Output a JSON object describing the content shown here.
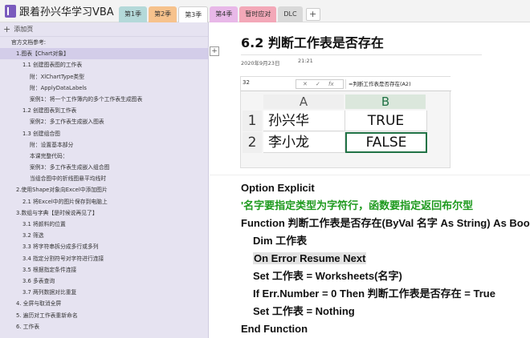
{
  "notebook": {
    "title": "跟着孙兴华学习VBA"
  },
  "section_tabs": [
    {
      "label": "第1季",
      "color": "#b4d9d9"
    },
    {
      "label": "第2季",
      "color": "#f6c28c"
    },
    {
      "label": "第3季",
      "color": "#ffffff"
    },
    {
      "label": "第4季",
      "color": "#e8b8e8"
    },
    {
      "label": "暂时应对",
      "color": "#f3a8b8"
    },
    {
      "label": "DLC",
      "color": "#d9d9d9"
    }
  ],
  "sidebar": {
    "add_page": "添加页",
    "items": [
      {
        "label": "官方文档参考:",
        "level": 0
      },
      {
        "label": "1.图表【Chart对象】",
        "level": 1,
        "selected": true
      },
      {
        "label": "1.1 创建图表图的工作表",
        "level": 2
      },
      {
        "label": "附：XlChartType类型",
        "level": 3
      },
      {
        "label": "附：ApplyDataLabels",
        "level": 3
      },
      {
        "label": "案例1：将一个工作簿内的多个工作表生成图表",
        "level": 3
      },
      {
        "label": "1.2 创建图表到工作表",
        "level": 2
      },
      {
        "label": "案例2：多工作表生成嵌入图表",
        "level": 3
      },
      {
        "label": "1.3 创建组合图",
        "level": 2
      },
      {
        "label": "附：设置基本部分",
        "level": 3
      },
      {
        "label": "本课完整代码：",
        "level": 3
      },
      {
        "label": "案例3：多工作表生成嵌入组合图",
        "level": 3
      },
      {
        "label": "当组合图中的折线图悬平均线时",
        "level": 3
      },
      {
        "label": "2.使用Shape对象向Excel中添加图片",
        "level": 1
      },
      {
        "label": "2.1 将Excel中的图片保存到电脑上",
        "level": 2
      },
      {
        "label": "3.数组与字典【是时候说再见了】",
        "level": 1
      },
      {
        "label": "3.1 将颜料的位置",
        "level": 2
      },
      {
        "label": "3.2 筛选",
        "level": 2
      },
      {
        "label": "3.3 将字符串拆分成多行或多列",
        "level": 2
      },
      {
        "label": "3.4 指定分割符号对字符进行连接",
        "level": 2
      },
      {
        "label": "3.5 根据指定条件连接",
        "level": 2
      },
      {
        "label": "3.6 多表查询",
        "level": 2
      },
      {
        "label": "3.7 两列数据对比重复",
        "level": 2
      },
      {
        "label": "4. 全屏与取消全屏",
        "level": 1
      },
      {
        "label": "5. 遍历对工作表重新命名",
        "level": 1
      },
      {
        "label": "6. 工作表",
        "level": 1
      }
    ]
  },
  "page": {
    "title": "6.2 判断工作表是否存在",
    "date": "2020年9月23日",
    "time": "21:21"
  },
  "excel": {
    "name_box": "32",
    "cancel_icon": "✕",
    "enter_icon": "✓",
    "fx_label": "fx",
    "formula": "=判断工作表是否存在(A2)",
    "columns": [
      "A",
      "B"
    ],
    "rows": [
      {
        "num": "1",
        "a": "孙兴华",
        "b": "TRUE"
      },
      {
        "num": "2",
        "a": "李小龙",
        "b": "FALSE"
      }
    ]
  },
  "code": {
    "lines": [
      {
        "text": "Option Explicit",
        "type": "normal"
      },
      {
        "text": "'名字要指定类型为字符行，函数要指定返回布尔型",
        "type": "comment"
      },
      {
        "text": "Function 判断工作表是否存在(ByVal 名字 As String) As Boolean",
        "type": "normal"
      },
      {
        "text": "Dim 工作表",
        "type": "indent"
      },
      {
        "text": "On Error Resume Next",
        "type": "indent-highlight"
      },
      {
        "text": "Set 工作表 = Worksheets(名字)",
        "type": "indent"
      },
      {
        "text": "If Err.Number = 0 Then 判断工作表是否存在 = True",
        "type": "indent"
      },
      {
        "text": "Set 工作表 = Nothing",
        "type": "indent"
      },
      {
        "text": "End Function",
        "type": "normal"
      }
    ]
  }
}
